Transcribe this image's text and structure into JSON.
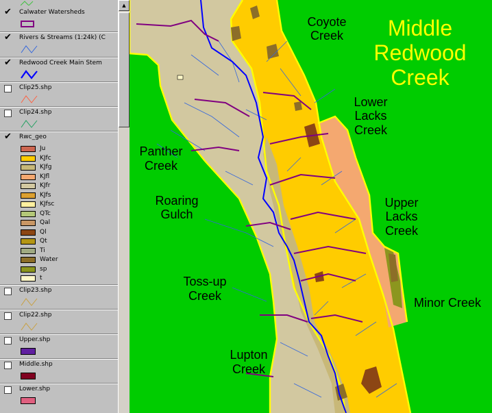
{
  "toc": {
    "layers": [
      {
        "label": "Calwater Watersheds",
        "checked": true
      },
      {
        "label": "Rivers & Streams (1:24k) (C",
        "checked": true
      },
      {
        "label": "Redwood Creek Main Stem",
        "checked": true
      },
      {
        "label": "Clip25.shp",
        "checked": false
      },
      {
        "label": "Clip24.shp",
        "checked": false
      },
      {
        "label": "Rwc_geo",
        "checked": true
      },
      {
        "label": "Clip23.shp",
        "checked": false
      },
      {
        "label": "Clip22.shp",
        "checked": false
      },
      {
        "label": "Upper.shp",
        "checked": false
      },
      {
        "label": "Middle.shp",
        "checked": false
      },
      {
        "label": "Lower.shp",
        "checked": false
      }
    ],
    "geo_classes": [
      {
        "label": "Ju",
        "color": "#cd6650"
      },
      {
        "label": "KJfc",
        "color": "#ffcc00"
      },
      {
        "label": "KJfg",
        "color": "#c8b878"
      },
      {
        "label": "KJfl",
        "color": "#f4a870"
      },
      {
        "label": "KJfr",
        "color": "#d2c8a0"
      },
      {
        "label": "KJfs",
        "color": "#dca030"
      },
      {
        "label": "KJfsc",
        "color": "#fff0a0"
      },
      {
        "label": "QTc",
        "color": "#b4c878"
      },
      {
        "label": "Qal",
        "color": "#c89664"
      },
      {
        "label": "Ql",
        "color": "#8c4614"
      },
      {
        "label": "Qt",
        "color": "#b49614"
      },
      {
        "label": "Ti",
        "color": "#a0aa82"
      },
      {
        "label": "Water",
        "color": "#8c6e28"
      },
      {
        "label": "sp",
        "color": "#8c961e"
      },
      {
        "label": "t",
        "color": "#fff8c8"
      }
    ]
  },
  "map": {
    "labels": {
      "coyote": [
        "Coyote",
        "Creek"
      ],
      "middle_redwood": [
        "Middle",
        "Redwood",
        "Creek"
      ],
      "lower_lacks": [
        "Lower",
        "Lacks",
        "Creek"
      ],
      "panther": [
        "Panther",
        "Creek"
      ],
      "roaring": [
        "Roaring",
        "Gulch"
      ],
      "upper_lacks": [
        "Upper",
        "Lacks",
        "Creek"
      ],
      "tossup": [
        "Toss-up",
        "Creek"
      ],
      "minor": "Minor Creek",
      "lupton": [
        "Lupton",
        "Creek"
      ]
    },
    "colors": {
      "background": "#00cc00",
      "watershed_boundary": "#ffff00",
      "stream": "#3366dd",
      "main_stem": "#0000ff",
      "divide": "#800080",
      "title": "#ffff00"
    }
  }
}
